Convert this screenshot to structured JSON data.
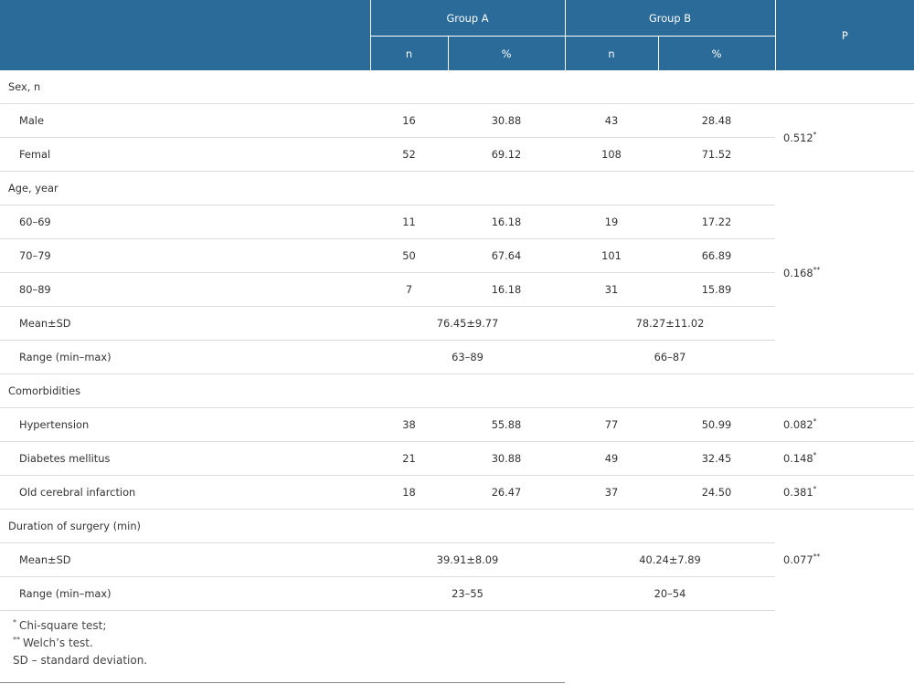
{
  "table": {
    "header": {
      "group_a": "Group A",
      "group_b": "Group B",
      "p": "P",
      "n": "n",
      "pct": "%"
    },
    "sections": {
      "sex": {
        "title": "Sex, n",
        "p": "0.512",
        "p_mark": "*",
        "rows": [
          {
            "label": "Male",
            "a_n": "16",
            "a_pct": "30.88",
            "b_n": "43",
            "b_pct": "28.48"
          },
          {
            "label": "Femal",
            "a_n": "52",
            "a_pct": "69.12",
            "b_n": "108",
            "b_pct": "71.52"
          }
        ]
      },
      "age": {
        "title": "Age, year",
        "p": "0.168",
        "p_mark": "**",
        "rows": [
          {
            "label": "60–69",
            "a_n": "11",
            "a_pct": "16.18",
            "b_n": "19",
            "b_pct": "17.22"
          },
          {
            "label": "70–79",
            "a_n": "50",
            "a_pct": "67.64",
            "b_n": "101",
            "b_pct": "66.89"
          },
          {
            "label": "80–89",
            "a_n": "7",
            "a_pct": "16.18",
            "b_n": "31",
            "b_pct": "15.89"
          }
        ],
        "mean": {
          "label": "Mean±SD",
          "a": "76.45±9.77",
          "b": "78.27±11.02"
        },
        "range": {
          "label": "Range (min–max)",
          "a": "63–89",
          "b": "66–87"
        }
      },
      "comorbidities": {
        "title": "Comorbidities",
        "rows": [
          {
            "label": "Hypertension",
            "a_n": "38",
            "a_pct": "55.88",
            "b_n": "77",
            "b_pct": "50.99",
            "p": "0.082",
            "p_mark": "*"
          },
          {
            "label": "Diabetes mellitus",
            "a_n": "21",
            "a_pct": "30.88",
            "b_n": "49",
            "b_pct": "32.45",
            "p": "0.148",
            "p_mark": "*"
          },
          {
            "label": "Old cerebral infarction",
            "a_n": "18",
            "a_pct": "26.47",
            "b_n": "37",
            "b_pct": "24.50",
            "p": "0.381",
            "p_mark": "*"
          }
        ]
      },
      "surgery": {
        "title": "Duration of surgery (min)",
        "p": "0.077",
        "p_mark": "**",
        "mean": {
          "label": "Mean±SD",
          "a": "39.91±8.09",
          "b": "40.24±7.89"
        },
        "range": {
          "label": "Range (min–max)",
          "a": "23–55",
          "b": "20–54"
        }
      }
    }
  },
  "footnotes": [
    {
      "mark": "*",
      "text": "Chi-square test;"
    },
    {
      "mark": "**",
      "text": "Welch’s test."
    },
    {
      "mark": "",
      "text": "SD – standard deviation."
    }
  ],
  "colors": {
    "header_bg": "#2a6b9a",
    "header_text": "#ffffff",
    "row_border": "#dcdcdc"
  }
}
